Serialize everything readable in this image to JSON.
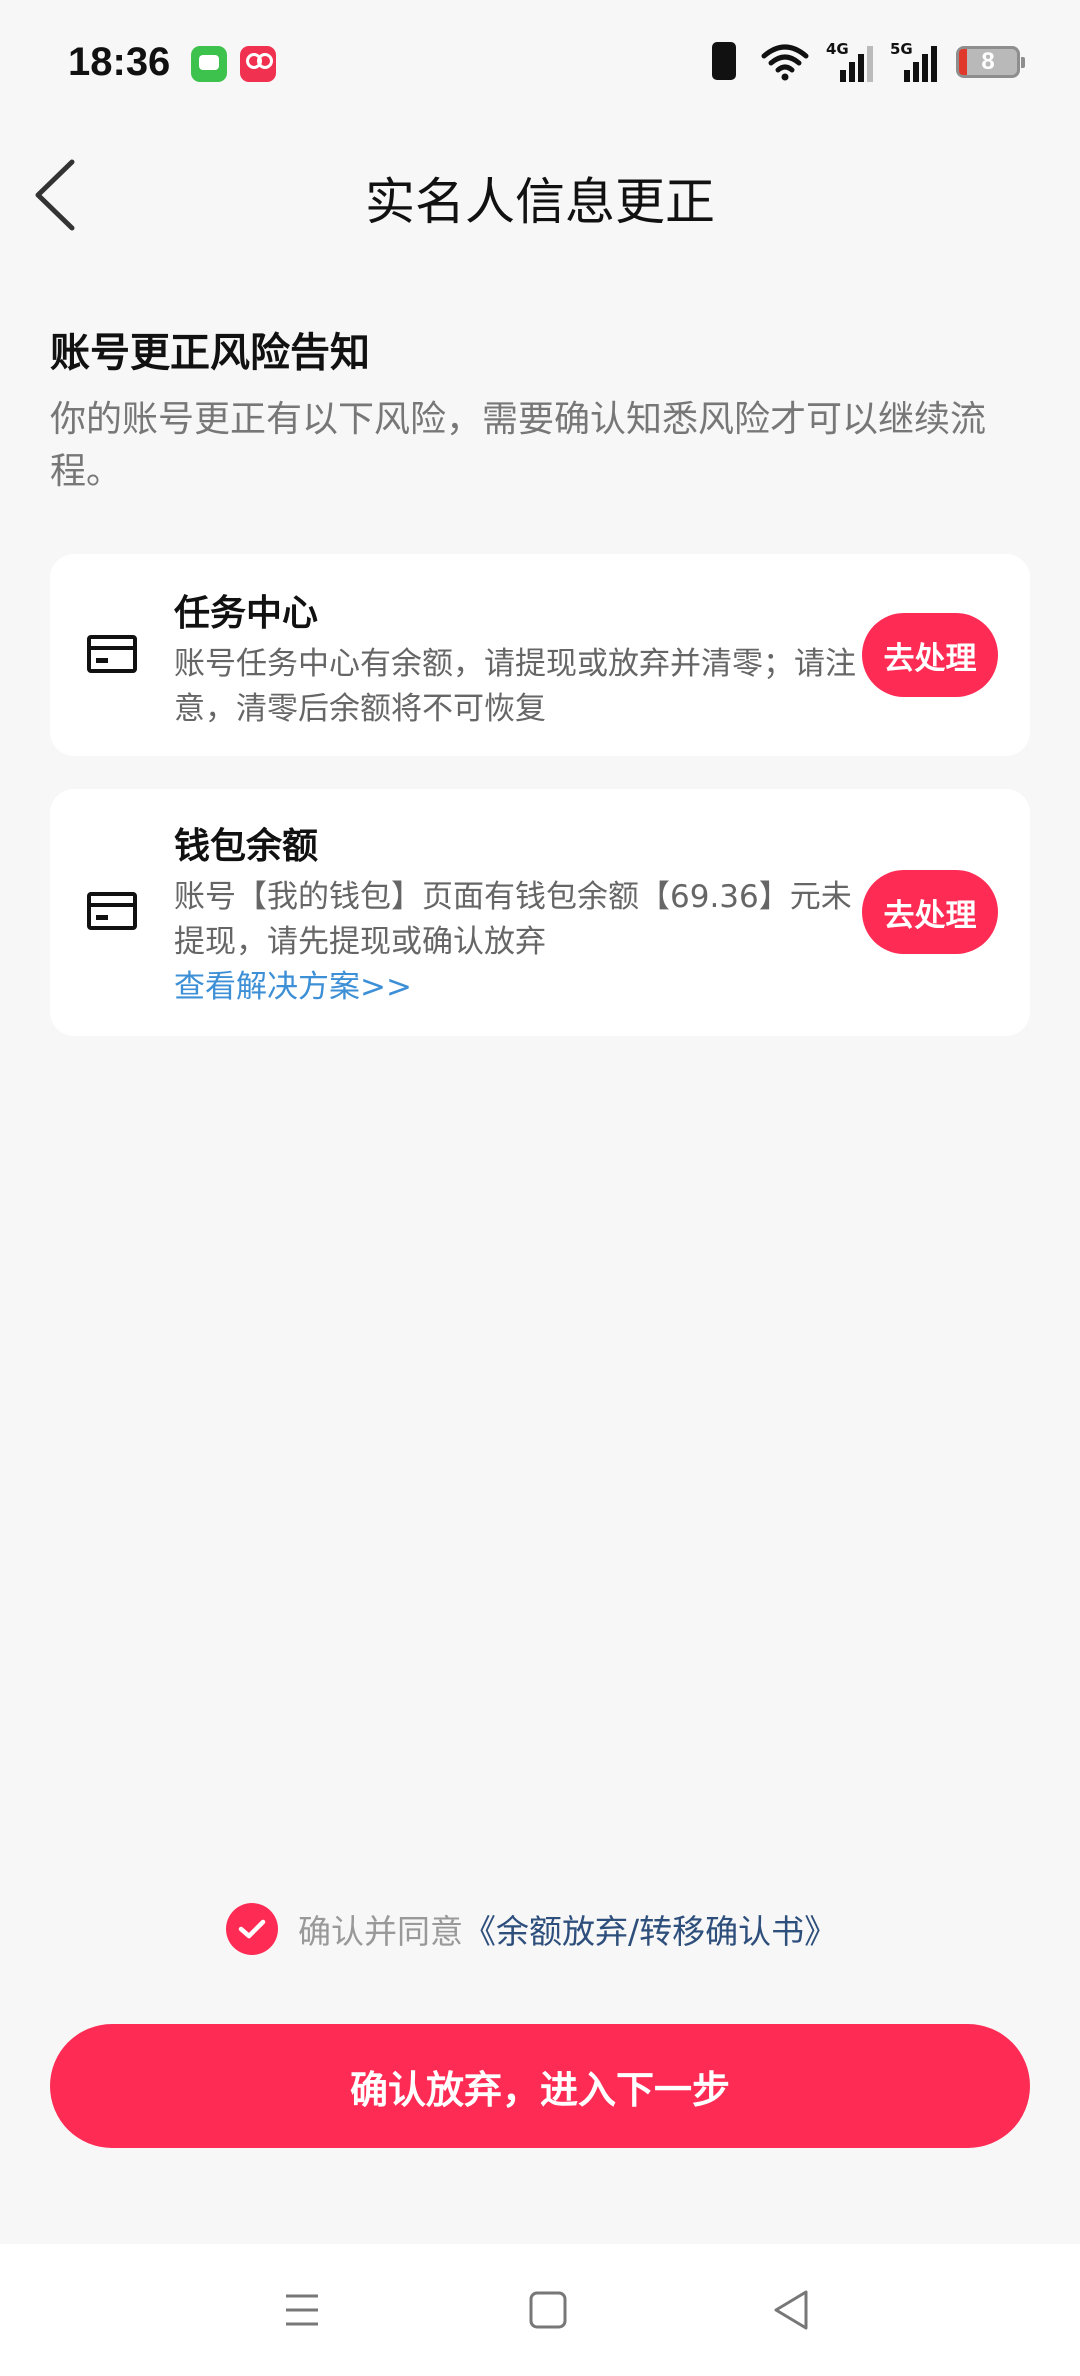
{
  "status_bar": {
    "time": "18:36",
    "network_1": "4G",
    "network_2": "5G",
    "battery": "8",
    "icons": [
      "messages-app-icon",
      "video-app-icon",
      "vibrate-icon",
      "wifi-icon",
      "signal-icon",
      "battery-icon"
    ]
  },
  "header": {
    "title": "实名人信息更正",
    "back_icon": "chevron-left-icon"
  },
  "notice": {
    "title": "账号更正风险告知",
    "description": "你的账号更正有以下风险，需要确认知悉风险才可以继续流程。"
  },
  "items": [
    {
      "title": "任务中心",
      "description": "账号任务中心有余额，请提现或放弃并清零；请注意，清零后余额将不可恢复",
      "action": "去处理",
      "icon": "card-icon"
    },
    {
      "title": "钱包余额",
      "description": "账号【我的钱包】页面有钱包余额【69.36】元未提现，请先提现或确认放弃",
      "link": "查看解决方案>>",
      "action": "去处理",
      "icon": "card-icon"
    }
  ],
  "agreement": {
    "checked": true,
    "text": "确认并同意",
    "link": "《余额放弃/转移确认书》"
  },
  "primary_button": "确认放弃，进入下一步",
  "colors": {
    "accent": "#fe2c55",
    "link": "#3d8fd6",
    "background": "#f7f7f7"
  },
  "nav_bar": {
    "icons": [
      "menu-icon",
      "home-icon",
      "back-triangle-icon"
    ]
  }
}
